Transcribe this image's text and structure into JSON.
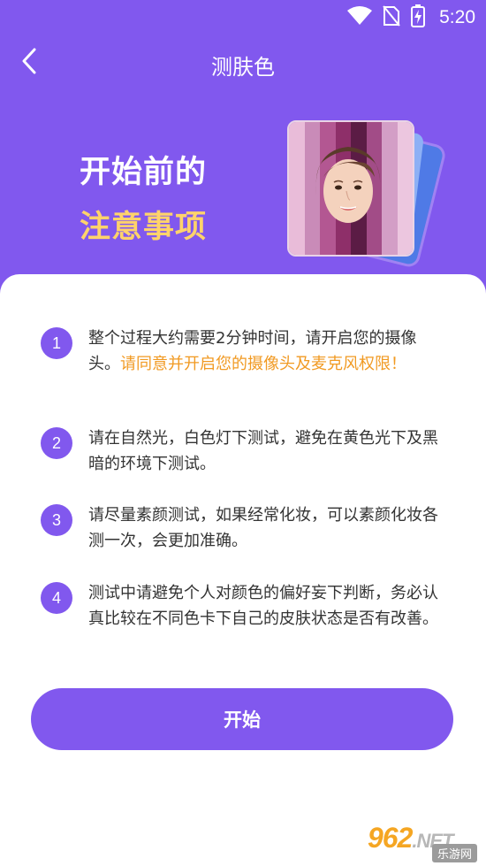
{
  "status_bar": {
    "time": "5:20",
    "icons": [
      "wifi-icon",
      "no-sim-icon",
      "battery-charging-icon"
    ]
  },
  "nav": {
    "title": "测肤色",
    "back_icon": "chevron-left-icon"
  },
  "hero": {
    "line1": "开始前的",
    "line2": "注意事项",
    "illustration": "color-card-with-face"
  },
  "tips": [
    {
      "num": "1",
      "text": "整个过程大约需要2分钟时间，请开启您的摄像头。",
      "warning": "请同意并开启您的摄像头及麦克风权限！"
    },
    {
      "num": "2",
      "text": "请在自然光，白色灯下测试，避免在黄色光下及黑暗的环境下测试。",
      "warning": ""
    },
    {
      "num": "3",
      "text": "请尽量素颜测试，如果经常化妆，可以素颜化妆各测一次，会更加准确。",
      "warning": ""
    },
    {
      "num": "4",
      "text": "测试中请避免个人对颜色的偏好妄下判断，务必认真比较在不同色卡下自己的皮肤状态是否有改善。",
      "warning": ""
    }
  ],
  "start_button": {
    "label": "开始"
  },
  "watermark": {
    "brand": "962",
    "suffix": ".NET",
    "sub": "乐游网"
  },
  "colors": {
    "primary": "#8158ee",
    "highlight": "#ffd36b",
    "warning": "#f19a23",
    "text": "#333333",
    "card_stripes": [
      "#e9bcd9",
      "#c98bb8",
      "#b35792",
      "#8e2f69",
      "#5b1c45",
      "#a24c87",
      "#d39ec6",
      "#ecc6df"
    ]
  }
}
